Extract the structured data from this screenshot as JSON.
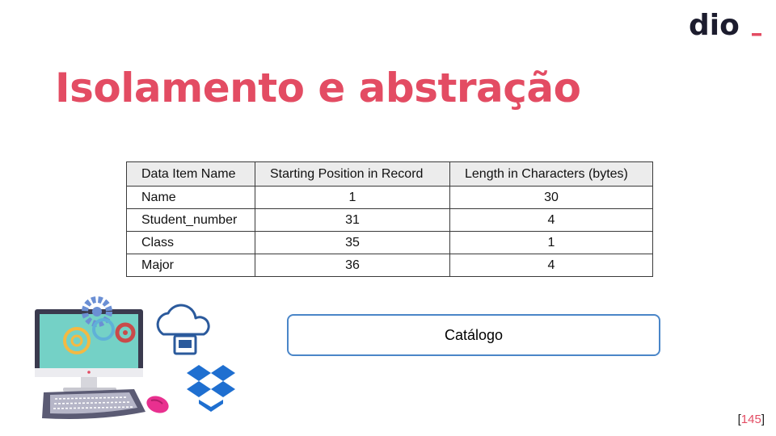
{
  "slide": {
    "title": "Isolamento e abstração",
    "brand": {
      "logo_text": "dio",
      "accent": "#e34c63",
      "dark": "#1c1c2e"
    }
  },
  "table": {
    "headers": [
      "Data Item Name",
      "Starting Position in Record",
      "Length in Characters (bytes)"
    ],
    "rows": [
      {
        "name": "Name",
        "start": "1",
        "length": "30"
      },
      {
        "name": "Student_number",
        "start": "31",
        "length": "4"
      },
      {
        "name": "Class",
        "start": "35",
        "length": "1"
      },
      {
        "name": "Major",
        "start": "36",
        "length": "4"
      }
    ]
  },
  "catalog_box": {
    "label": "Catálogo",
    "border_color": "#4a86c8"
  },
  "page": {
    "open": "[",
    "number": "145",
    "close": "]"
  },
  "icons": [
    "computer-icon",
    "gears-icon",
    "cloud-icon",
    "dropbox-icon",
    "mouse-icon"
  ]
}
